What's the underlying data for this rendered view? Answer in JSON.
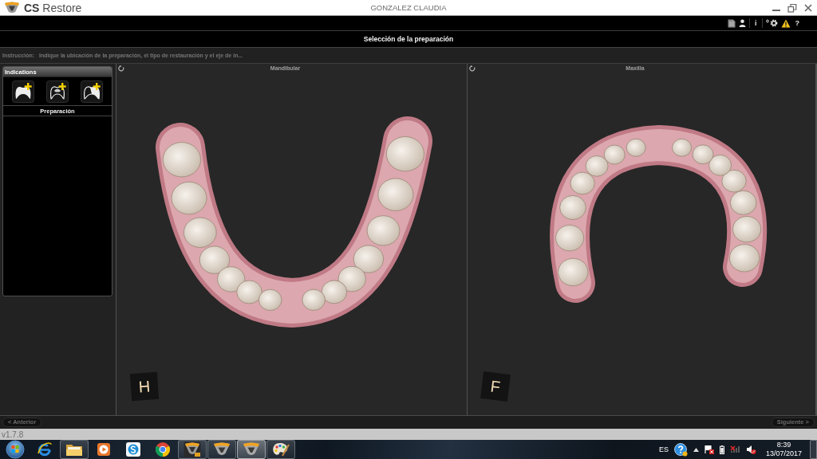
{
  "window": {
    "app_name": "**CS** Restore",
    "title": "GONZALEZ CLAUDIA"
  },
  "toolbar": {
    "items": [
      {
        "kind": "document"
      },
      {
        "kind": "user"
      },
      {
        "kind": "info",
        "text": "i"
      },
      {
        "kind": "settings"
      },
      {
        "kind": "warning"
      },
      {
        "kind": "help",
        "text": "?"
      }
    ]
  },
  "header": {
    "title": "Selección de la preparación"
  },
  "instruction": {
    "label": "Instrucción:",
    "text": "Indique la ubicación de la preparación, el tipo de restauración y el eje de in..."
  },
  "indications": {
    "title": "Indications",
    "tools": [
      {
        "kind": "solid"
      },
      {
        "kind": "outline"
      },
      {
        "kind": "partial"
      }
    ],
    "section": "Preparación"
  },
  "viewports": [
    {
      "title": "Mandibular",
      "kind": "lower",
      "cube": "H"
    },
    {
      "title": "Maxilla",
      "kind": "upper",
      "cube": "F"
    }
  ],
  "navigation": {
    "back": {
      "label": "< Anterior",
      "disabled": true
    },
    "next": {
      "label": "Siguiente >",
      "disabled": true
    }
  },
  "status_bar": {
    "version": "v1.7.8"
  },
  "taskbar": {
    "apps": [
      {
        "kind": "e-letter",
        "running": false,
        "selected": false
      },
      {
        "kind": "folder",
        "running": true,
        "selected": false
      },
      {
        "kind": "play",
        "running": false,
        "selected": false
      },
      {
        "kind": "swirl",
        "running": false,
        "selected": false
      },
      {
        "kind": "wheel",
        "running": false,
        "selected": false
      },
      {
        "kind": "shield-cs",
        "running": true,
        "selected": false
      },
      {
        "kind": "shield",
        "running": true,
        "selected": false
      },
      {
        "kind": "shield",
        "running": true,
        "selected": true
      },
      {
        "kind": "palette",
        "running": true,
        "selected": false
      }
    ],
    "tray": {
      "language": "ES",
      "network_connected": false,
      "muted": true,
      "time": "8:39",
      "date": "13/07/2017"
    }
  }
}
